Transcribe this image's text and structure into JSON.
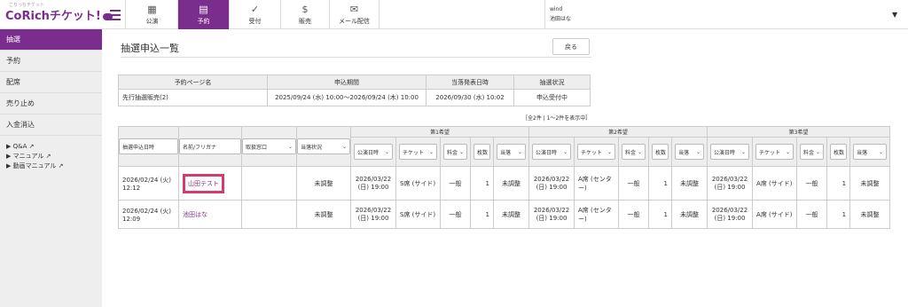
{
  "brand": {
    "logo_text": "CoRichチケット!",
    "logo_small": "こりっちチケット"
  },
  "nav": [
    {
      "label": "公演",
      "icon": "building-icon"
    },
    {
      "label": "予約",
      "icon": "calendar-icon"
    },
    {
      "label": "受付",
      "icon": "check-icon"
    },
    {
      "label": "販売",
      "icon": "dollar-icon"
    },
    {
      "label": "メール配信",
      "icon": "mail-icon"
    }
  ],
  "user": {
    "line1": "wind",
    "line2": "池田はな"
  },
  "sidebar": {
    "items": [
      {
        "label": "抽選"
      },
      {
        "label": "予約"
      },
      {
        "label": "配席"
      },
      {
        "label": "売り止め"
      },
      {
        "label": "入金消込"
      }
    ],
    "links": [
      {
        "label": "▶ Q&A"
      },
      {
        "label": "▶ マニュアル"
      },
      {
        "label": "▶ 動画マニュアル"
      }
    ]
  },
  "page": {
    "title": "抽選申込一覧",
    "back": "戻る",
    "count": "［全2件 | 1～2件を表示中］"
  },
  "summary": {
    "headers": [
      "予約ページ名",
      "申込期間",
      "当落発表日時",
      "抽選状況"
    ],
    "row": [
      "先行抽選販売(2)",
      "2025/09/24 (水) 10:00～2026/09/24 (木) 10:00",
      "2026/09/30 (水) 10:02",
      "申込受付中"
    ]
  },
  "table": {
    "groups": [
      "第1希望",
      "第2希望",
      "第3希望"
    ],
    "filters": [
      "抽選申込日時",
      "名前/フリガナ",
      "取扱窓口",
      "当落状況"
    ],
    "pref_filters": [
      "公演日時",
      "チケット",
      "料金",
      "枚数",
      "当落"
    ],
    "rows": [
      {
        "date1": "2026/02/24 (火)",
        "date2": "12:12",
        "name": "山田テスト",
        "window": "",
        "status": "未調整",
        "prefs": [
          {
            "d1": "2026/03/22",
            "d2": "(日) 19:00",
            "ticket": "S席 (サイド)",
            "price": "一般",
            "qty": "1",
            "status": "未調整"
          },
          {
            "d1": "2026/03/22",
            "d2": "(日) 19:00",
            "ticket": "A席 (センター)",
            "price": "一般",
            "qty": "1",
            "status": "未調整"
          },
          {
            "d1": "2026/03/22",
            "d2": "(日) 19:00",
            "ticket": "A席 (サイド)",
            "price": "一般",
            "qty": "1",
            "status": "未調整"
          }
        ]
      },
      {
        "date1": "2026/02/24 (火)",
        "date2": "12:09",
        "name": "池田はな",
        "window": "",
        "status": "未調整",
        "prefs": [
          {
            "d1": "2026/03/22",
            "d2": "(日) 19:00",
            "ticket": "S席 (サイド)",
            "price": "一般",
            "qty": "1",
            "status": "未調整"
          },
          {
            "d1": "2026/03/22",
            "d2": "(日) 19:00",
            "ticket": "A席 (センター)",
            "price": "一般",
            "qty": "1",
            "status": "未調整"
          },
          {
            "d1": "2026/03/22",
            "d2": "(日) 19:00",
            "ticket": "A席 (サイド)",
            "price": "一般",
            "qty": "1",
            "status": "未調整"
          }
        ]
      }
    ]
  }
}
